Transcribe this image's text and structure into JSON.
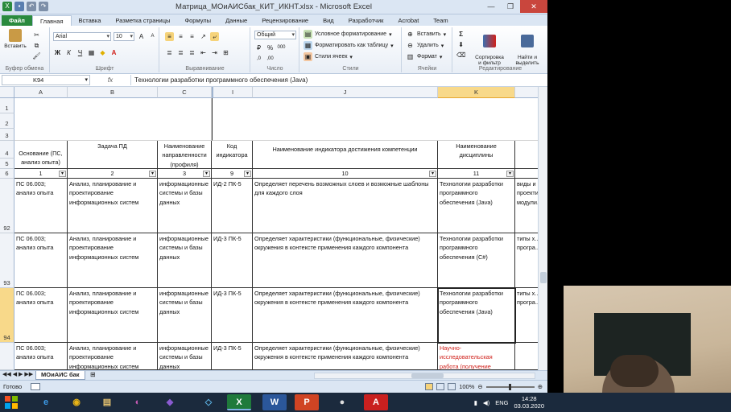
{
  "window": {
    "title": "Матрица_МОиАИСбак_КИТ_ИКНТ.xlsx - Microsoft Excel",
    "controls": [
      "—",
      "❐",
      "✕"
    ]
  },
  "ribbon_tabs": [
    "Файл",
    "Главная",
    "Вставка",
    "Разметка страницы",
    "Формулы",
    "Данные",
    "Рецензирование",
    "Вид",
    "Разработчик",
    "Acrobat",
    "Team"
  ],
  "ribbon": {
    "clipboard": {
      "paste": "Вставить",
      "label": "Буфер обмена"
    },
    "font": {
      "name": "Arial",
      "size": "10",
      "label": "Шрифт",
      "bold": "Ж",
      "italic": "К",
      "underline": "Ч"
    },
    "alignment": {
      "label": "Выравнивание"
    },
    "number": {
      "format": "Общий",
      "label": "Число",
      "percent": "%",
      "thousands": "000"
    },
    "styles": {
      "cond": "Условное форматирование",
      "table": "Форматировать как таблицу",
      "cell": "Стили ячеек",
      "label": "Стили"
    },
    "cells": {
      "insert": "Вставить",
      "delete": "Удалить",
      "format": "Формат",
      "label": "Ячейки"
    },
    "editing": {
      "sort": "Сортировка\nи фильтр",
      "find": "Найти и\nвыделить",
      "label": "Редактирование"
    }
  },
  "formula_bar": {
    "name_box": "K94",
    "fx": "fx",
    "value": "Технологии разработки программного обеспечения (Java)"
  },
  "columns": [
    {
      "letter": "A",
      "selected": false
    },
    {
      "letter": "B",
      "selected": false
    },
    {
      "letter": "C",
      "selected": false
    },
    {
      "letter": "I",
      "selected": false
    },
    {
      "letter": "J",
      "selected": false
    },
    {
      "letter": "K",
      "selected": true
    },
    {
      "letter": "",
      "selected": false
    }
  ],
  "rows": [
    "1",
    "2",
    "3",
    "4",
    "5",
    "6",
    "92",
    "93",
    "94",
    ""
  ],
  "header_row": [
    "Основание (ПС, анализ опыта)",
    "Задача ПД",
    "Наименование направленности (профиля)",
    "Код индикатора",
    "Наименование индикатора достижения компетенции",
    "Наименование дисциплины"
  ],
  "number_row": [
    "1",
    "2",
    "3",
    "9",
    "10",
    "11"
  ],
  "data_rows": [
    {
      "row": "92",
      "a": "ПС 06.003; анализ опыта",
      "b": "Анализ, планирование и проектирование информационных систем",
      "c": "информационные системы и базы данных",
      "i": "ИД-2 ПК-5",
      "j": "Определяет перечень возможных слоев и возможные шаблоны для каждого слоя",
      "k": "Технологии разработки программного обеспечения (Java)",
      "l": "виды и проекти... модули..."
    },
    {
      "row": "93",
      "a": "ПС 06.003; анализ опыта",
      "b": "Анализ, планирование и проектирование информационных систем",
      "c": "информационные системы и базы данных",
      "i": "ИД-3 ПК-5",
      "j": "Определяет характеристики (функциональные, физические) окружения в контексте применения каждого компонента",
      "k": "Технологии разработки программного обеспечения (С#)",
      "l": "типы х... програ..."
    },
    {
      "row": "94",
      "a": "ПС 06.003; анализ опыта",
      "b": "Анализ, планирование и проектирование информационных систем",
      "c": "информационные системы и базы данных",
      "i": "ИД-3 ПК-5",
      "j": "Определяет характеристики (функциональные, физические) окружения в контексте применения каждого компонента",
      "k": "Технологии разработки программного обеспечения (Java)",
      "l": "типы х... програ..."
    },
    {
      "row": "",
      "a": "ПС 06.003; анализ опыта",
      "b": "Анализ, планирование и проектирование информационных систем",
      "c": "информационные системы и базы данных",
      "i": "ИД-3 ПК-5",
      "j": "Определяет характеристики (функциональные, физические) окружения в контексте применения каждого компонента",
      "k": "Научно-исследовательская работа (получение",
      "l": ""
    }
  ],
  "sheet_tab": "МОиАИС бак",
  "status": {
    "ready": "Готово",
    "zoom": "100%"
  },
  "taskbar": {
    "apps": [
      "e",
      "◉",
      "▤",
      "◐",
      "◆",
      "◇",
      "X",
      "W",
      "P",
      "●",
      "A"
    ],
    "language": "ENG",
    "time": "14:28",
    "date": "03.03.2020"
  },
  "colors": {
    "excel_green": "#2a8a3e",
    "selection": "#f8d98a",
    "red_text": "#d0211b"
  }
}
